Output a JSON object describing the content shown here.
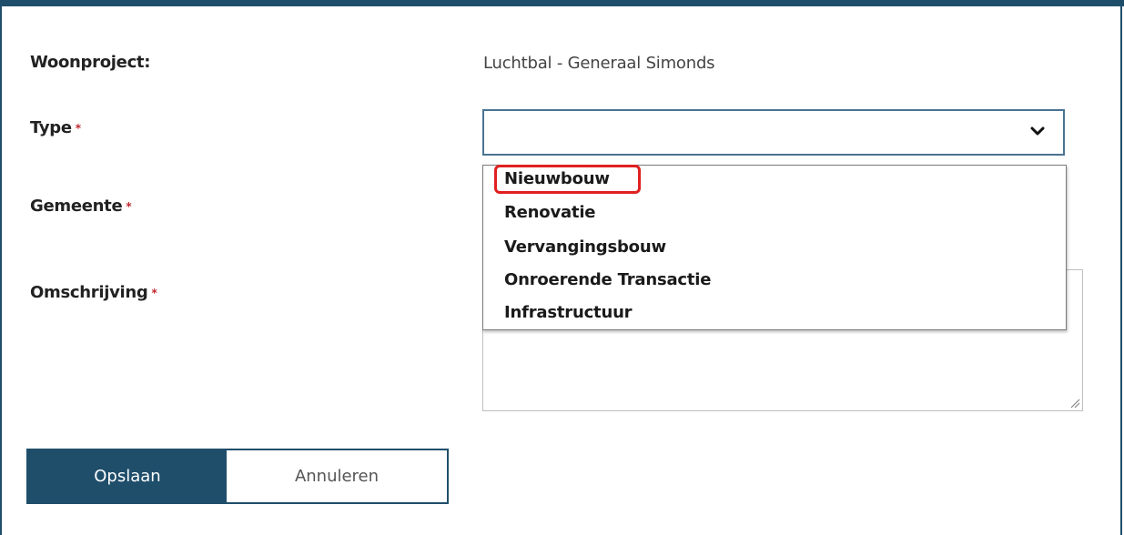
{
  "form": {
    "woonproject_label": "Woonproject:",
    "woonproject_value": "Luchtbal - Generaal Simonds",
    "type_label": "Type",
    "gemeente_label": "Gemeente",
    "omschrijving_label": "Omschrijving",
    "required_marker": "*",
    "type_select_value": ""
  },
  "dropdown": {
    "options": [
      "Nieuwbouw",
      "Renovatie",
      "Vervangingsbouw",
      "Onroerende Transactie",
      "Infrastructuur"
    ],
    "highlighted": "Nieuwbouw"
  },
  "buttons": {
    "save_label": "Opslaan",
    "cancel_label": "Annuleren"
  },
  "colors": {
    "primary": "#1f4e6b",
    "required": "#c0262d",
    "highlight": "#e02020"
  },
  "icons": {
    "select_chevron": "chevron-down-icon",
    "resize": "resize-grip-icon"
  }
}
